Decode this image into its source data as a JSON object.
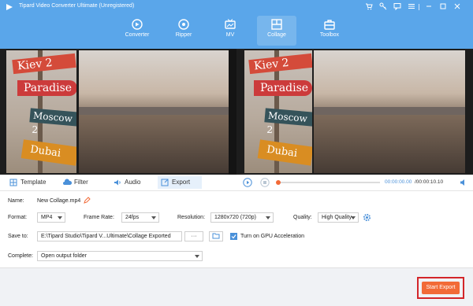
{
  "app": {
    "title": "Tipard Video Converter Ultimate (Unregistered)"
  },
  "nav": {
    "items": [
      {
        "label": "Converter"
      },
      {
        "label": "Ripper"
      },
      {
        "label": "MV"
      },
      {
        "label": "Collage",
        "active": true
      },
      {
        "label": "Toolbox"
      }
    ]
  },
  "preview": {
    "signs": [
      "Kiev",
      "Paradise",
      "Moscow",
      "Dubai"
    ],
    "numeral": "2"
  },
  "tabs": [
    {
      "label": "Template",
      "icon": "template-icon"
    },
    {
      "label": "Filter",
      "icon": "filter-icon"
    },
    {
      "label": "Audio",
      "icon": "audio-icon"
    },
    {
      "label": "Export",
      "icon": "export-icon",
      "active": true
    }
  ],
  "player": {
    "time_current": "00:00:00.00",
    "time_total": "/00:00:10.10",
    "progress": 0.0
  },
  "form": {
    "name_label": "Name:",
    "name_value": "New Collage.mp4",
    "format_label": "Format:",
    "format_value": "MP4",
    "framerate_label": "Frame Rate:",
    "framerate_value": "24fps",
    "resolution_label": "Resolution:",
    "resolution_value": "1280x720 (720p)",
    "quality_label": "Quality:",
    "quality_value": "High Quality",
    "saveto_label": "Save to:",
    "saveto_value": "E:\\Tipard Studio\\Tipard V...Ultimate\\Collage Exported",
    "browse_label": "···",
    "gpu_label": "Turn on GPU Acceleration",
    "gpu_checked": true,
    "complete_label": "Complete:",
    "complete_value": "Open output folder"
  },
  "footer": {
    "export_label": "Start Export"
  },
  "colors": {
    "accent": "#5aa6ea",
    "export": "#f26a37",
    "highlight": "#d3262a"
  }
}
